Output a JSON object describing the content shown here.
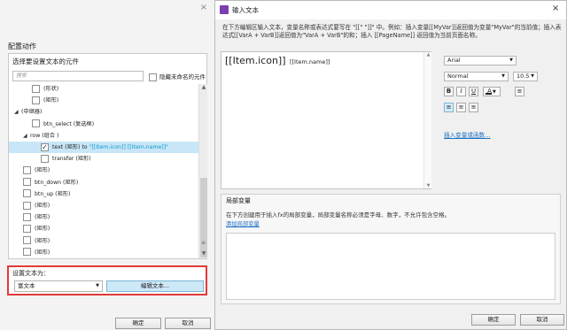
{
  "left_panel": {
    "close_glyph": "×",
    "section_title": "配置动作",
    "tree_header": "选择要设置文本的元件",
    "filter_placeholder": "搜索",
    "hide_unnamed_label": "隐藏未命名的元件",
    "tree_items": [
      {
        "label": "(形状)",
        "indent": 2,
        "checkbox": true,
        "checked": false,
        "twisty": "",
        "selected": false
      },
      {
        "label": "(矩形)",
        "indent": 2,
        "checkbox": true,
        "checked": false,
        "twisty": "",
        "selected": false
      },
      {
        "label": "(中继器)",
        "indent": 0,
        "checkbox": false,
        "checked": false,
        "twisty": "◢",
        "selected": false
      },
      {
        "label": "btn_select (复选框)",
        "indent": 2,
        "checkbox": true,
        "checked": false,
        "twisty": "",
        "selected": false
      },
      {
        "label": "row (组合 )",
        "indent": 1,
        "checkbox": false,
        "checked": false,
        "twisty": "◢",
        "selected": false
      },
      {
        "label": "text (矩形) to \"[[Item.icon]]   [[Item.name]]\"",
        "indent": 3,
        "checkbox": true,
        "checked": true,
        "twisty": "",
        "selected": true
      },
      {
        "label": "transfer (矩形)",
        "indent": 3,
        "checkbox": true,
        "checked": false,
        "twisty": "",
        "selected": false
      },
      {
        "label": "(矩形)",
        "indent": 1,
        "checkbox": true,
        "checked": false,
        "twisty": "",
        "selected": false
      },
      {
        "label": "btn_down (矩形)",
        "indent": 1,
        "checkbox": true,
        "checked": false,
        "twisty": "",
        "selected": false
      },
      {
        "label": "btn_up (矩形)",
        "indent": 1,
        "checkbox": true,
        "checked": false,
        "twisty": "",
        "selected": false
      },
      {
        "label": "(矩形)",
        "indent": 1,
        "checkbox": true,
        "checked": false,
        "twisty": "",
        "selected": false
      },
      {
        "label": "(矩形)",
        "indent": 1,
        "checkbox": true,
        "checked": false,
        "twisty": "",
        "selected": false
      },
      {
        "label": "(矩形)",
        "indent": 1,
        "checkbox": true,
        "checked": false,
        "twisty": "",
        "selected": false
      },
      {
        "label": "(矩形)",
        "indent": 1,
        "checkbox": true,
        "checked": false,
        "twisty": "",
        "selected": false
      },
      {
        "label": "(矩形)",
        "indent": 1,
        "checkbox": true,
        "checked": false,
        "twisty": "",
        "selected": false
      }
    ],
    "set_text_label": "设置文本为：",
    "set_text_type": "富文本",
    "edit_text_button": "编辑文本...",
    "ok_button": "确定",
    "cancel_button": "取消"
  },
  "dialog": {
    "title": "输入文本",
    "close_glyph": "×",
    "instructions": "在下方编辑区输入文本，变量名称或表达式要写在 \"[[\" \"]]\" 中。例如：插入变量[[MyVar]]返回值为变量\"MyVar\"的当前值；插入表达式[[VarA + VarB]]返回值为\"VarA + VarB\"的和；插入 [[PageName]] 返回值为当前页面名称。",
    "editor_big_text": "[[Item.icon]]",
    "editor_small_text": "[[Item.name]]",
    "font_family": "Arial",
    "font_style": "Normal",
    "font_size": "10.5",
    "bold": "B",
    "italic": "I",
    "underline": "U",
    "color_glyph": "A",
    "insert_var_link": "插入变量或函数...",
    "local_vars_title": "局部变量",
    "local_vars_desc": "在下方创建用于插入fx的局部变量，局部变量名称必须是字母、数字，不允许包含空格。",
    "add_local_var_link": "添加局部变量",
    "ok_button": "确定",
    "cancel_button": "取消"
  },
  "icons": [
    "checkbox-icon",
    "tree-expand-icon",
    "dropdown-arrow-icon",
    "scroll-up-icon",
    "scroll-down-icon",
    "close-icon",
    "app-icon",
    "align-left-icon",
    "align-center-icon",
    "align-right-icon",
    "bullet-list-icon",
    "font-color-icon"
  ],
  "colors": {
    "highlight_border": "#e23a3a",
    "selection": "#c9e6f8",
    "accent_button": "#cde8f7",
    "link": "#1a6fc3"
  }
}
